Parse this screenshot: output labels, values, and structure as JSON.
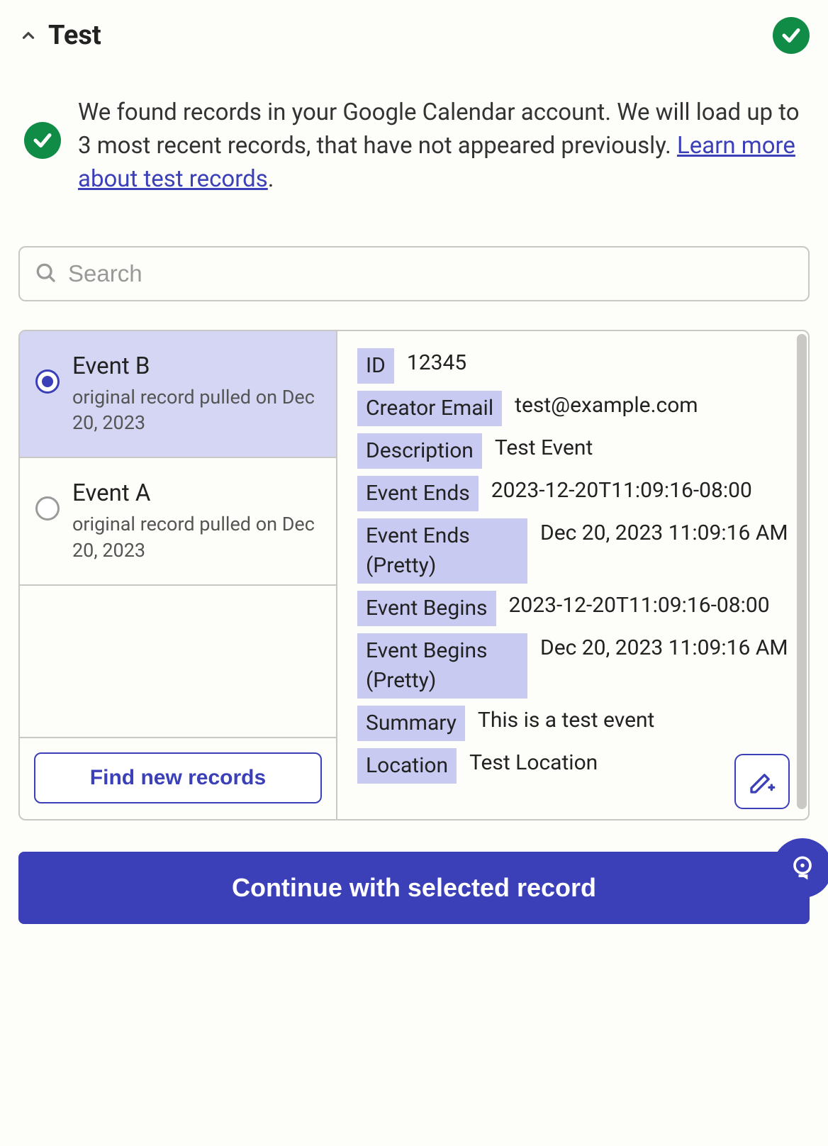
{
  "header": {
    "title": "Test"
  },
  "info": {
    "text_before_link": "We found records in your Google Calendar account. We will load up to 3 most recent records, that have not appeared previously. ",
    "link_text": "Learn more about test records",
    "trailing": "."
  },
  "search": {
    "placeholder": "Search"
  },
  "records": [
    {
      "title": "Event B",
      "subtitle": "original record pulled on Dec 20, 2023",
      "selected": true
    },
    {
      "title": "Event A",
      "subtitle": "original record pulled on Dec 20, 2023",
      "selected": false
    }
  ],
  "details": [
    {
      "key": "ID",
      "value": "12345"
    },
    {
      "key": "Creator Email",
      "value": "test@example.com"
    },
    {
      "key": "Description",
      "value": "Test Event"
    },
    {
      "key": "Event Ends",
      "value": "2023-12-20T11:09:16-08:00"
    },
    {
      "key": "Event Ends (Pretty)",
      "value": "Dec 20, 2023 11:09:16 AM"
    },
    {
      "key": "Event Begins",
      "value": "2023-12-20T11:09:16-08:00"
    },
    {
      "key": "Event Begins (Pretty)",
      "value": "Dec 20, 2023 11:09:16 AM"
    },
    {
      "key": "Summary",
      "value": "This is a test event"
    },
    {
      "key": "Location",
      "value": "Test Location"
    }
  ],
  "buttons": {
    "find_new": "Find new records",
    "continue": "Continue with selected record"
  }
}
